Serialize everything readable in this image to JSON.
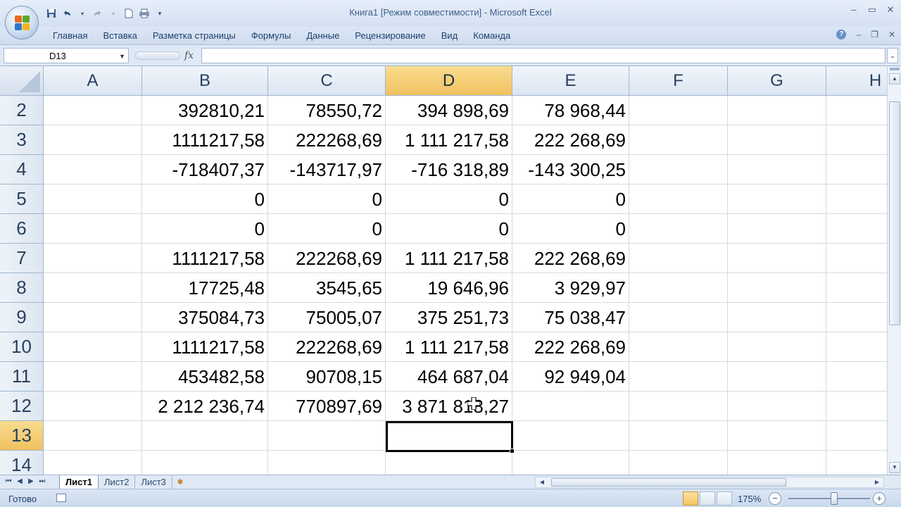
{
  "title": "Книга1  [Режим совместимости] - Microsoft Excel",
  "qat_icons": [
    "save-icon",
    "undo-icon",
    "redo-icon",
    "new-icon",
    "print-preview-icon"
  ],
  "ribbon_tabs": [
    "Главная",
    "Вставка",
    "Разметка страницы",
    "Формулы",
    "Данные",
    "Рецензирование",
    "Вид",
    "Команда"
  ],
  "formula_bar": {
    "name_box": "D13",
    "fx_label": "fx",
    "formula": ""
  },
  "columns": [
    "A",
    "B",
    "C",
    "D",
    "E",
    "F",
    "G",
    "H"
  ],
  "active_column": "D",
  "active_row": "13",
  "rows": [
    {
      "num": "2",
      "B": "392810,21",
      "C": "78550,72",
      "D": "394 898,69",
      "E": "78 968,44"
    },
    {
      "num": "3",
      "B": "1111217,58",
      "C": "222268,69",
      "D": "1 111 217,58",
      "E": "222 268,69"
    },
    {
      "num": "4",
      "B": "-718407,37",
      "C": "-143717,97",
      "D": "-716 318,89",
      "E": "-143 300,25"
    },
    {
      "num": "5",
      "B": "0",
      "C": "0",
      "D": "0",
      "E": "0"
    },
    {
      "num": "6",
      "B": "0",
      "C": "0",
      "D": "0",
      "E": "0"
    },
    {
      "num": "7",
      "B": "1111217,58",
      "C": "222268,69",
      "D": "1 111 217,58",
      "E": "222 268,69"
    },
    {
      "num": "8",
      "B": "17725,48",
      "C": "3545,65",
      "D": "19 646,96",
      "E": "3 929,97"
    },
    {
      "num": "9",
      "B": "375084,73",
      "C": "75005,07",
      "D": "375 251,73",
      "E": "75 038,47"
    },
    {
      "num": "10",
      "B": "1111217,58",
      "C": "222268,69",
      "D": "1 111 217,58",
      "E": "222 268,69"
    },
    {
      "num": "11",
      "B": "453482,58",
      "C": "90708,15",
      "D": "464 687,04",
      "E": "92 949,04"
    },
    {
      "num": "12",
      "B": "2 212 236,74",
      "C": "770897,69",
      "D": "3 871 818,27",
      "E": ""
    },
    {
      "num": "13",
      "B": "",
      "C": "",
      "D": "",
      "E": ""
    },
    {
      "num": "14",
      "B": "",
      "C": "",
      "D": "",
      "E": ""
    }
  ],
  "sheet_tabs": [
    "Лист1",
    "Лист2",
    "Лист3"
  ],
  "active_sheet": "Лист1",
  "status": {
    "text": "Готово",
    "zoom": "175%"
  }
}
